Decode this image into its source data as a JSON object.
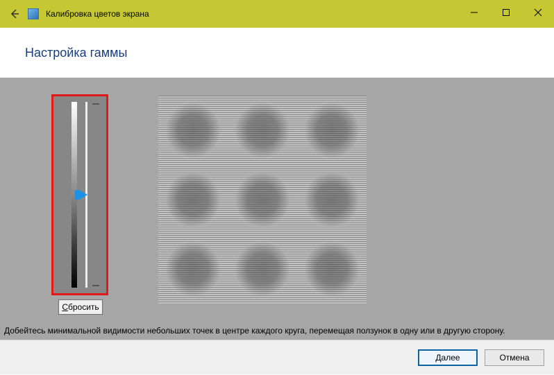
{
  "window": {
    "title": "Калибровка цветов экрана"
  },
  "page": {
    "heading": "Настройка гаммы",
    "reset_label": "Сбросить",
    "reset_underline_char": "С",
    "instruction": "Добейтесь минимальной видимости небольших точек в центре каждого круга, перемещая ползунок в одну или в другую сторону."
  },
  "footer": {
    "next_label": "Далее",
    "next_underline_char": "Д",
    "cancel_label": "Отмена"
  }
}
